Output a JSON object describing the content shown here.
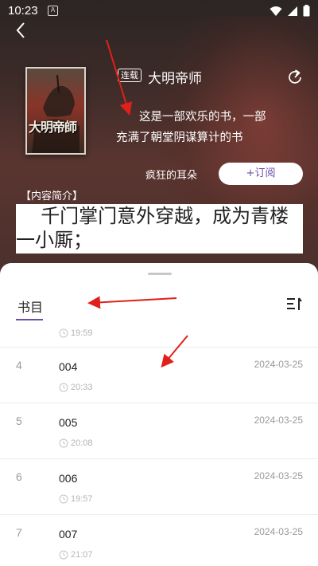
{
  "status_bar": {
    "time": "10:23",
    "notification_icon": "A"
  },
  "book": {
    "cover_title": "大明帝師",
    "serial_tag": "连载",
    "title": "大明帝师",
    "description": "这是一部欢乐的书，一部充满了朝堂阴谋算计的书",
    "author": "疯狂的耳朵",
    "subscribe_label": "+订阅"
  },
  "intro": {
    "label": "【内容简介】",
    "text": "千门掌门意外穿越，成为青楼一小厮；"
  },
  "toc": {
    "tab_label": "书目",
    "partial_time": "19:59",
    "chapters": [
      {
        "index": "4",
        "name": "004",
        "date": "2024-03-25",
        "time": "20:33"
      },
      {
        "index": "5",
        "name": "005",
        "date": "2024-03-25",
        "time": "20:08"
      },
      {
        "index": "6",
        "name": "006",
        "date": "2024-03-25",
        "time": "19:57"
      },
      {
        "index": "7",
        "name": "007",
        "date": "2024-03-25",
        "time": "21:07"
      }
    ]
  },
  "colors": {
    "accent": "#6b4ea8",
    "annotation": "#e0201a"
  },
  "icons": [
    "back-arrow-icon",
    "share-icon",
    "sort-icon",
    "clock-icon",
    "wifi-icon",
    "signal-icon",
    "battery-icon"
  ]
}
